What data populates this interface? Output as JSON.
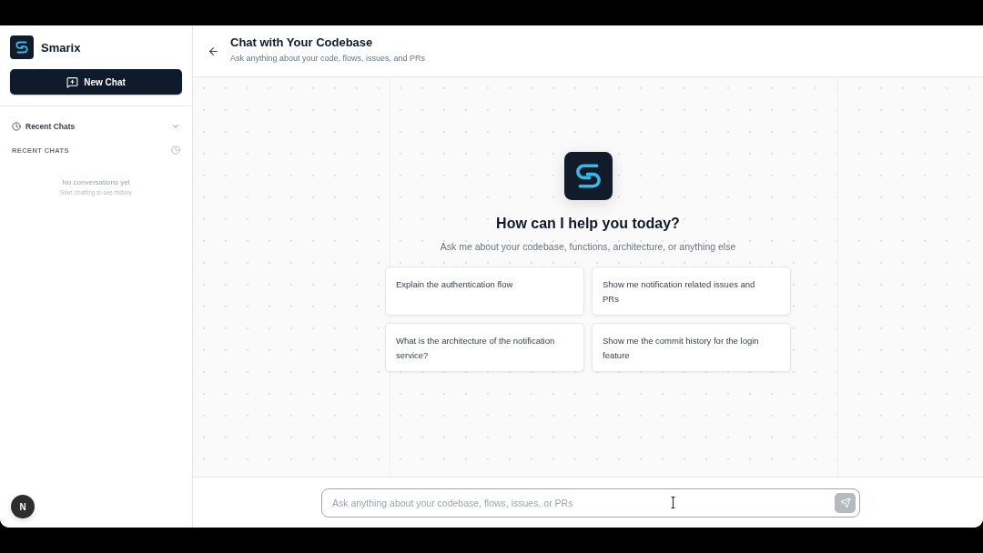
{
  "sidebar": {
    "brand": "Smarix",
    "new_chat_button": "New Chat",
    "recent_toggle": "Recent Chats",
    "history_heading": "RECENT CHATS",
    "empty_state": {
      "title": "No conversations yet",
      "subtitle": "Start chatting to see history"
    },
    "dev_badge": "N"
  },
  "header": {
    "title": "Chat with Your Codebase",
    "subtitle": "Ask anything about your code, flows, issues, and PRs"
  },
  "welcome": {
    "title": "How can I help you today?",
    "subtitle": "Ask me about your codebase, functions, architecture, or anything else"
  },
  "suggestions": [
    "Explain the authentication flow",
    "Show me notification related issues and PRs",
    "What is the architecture of the notification service?",
    "Show me the commit history for the login feature"
  ],
  "composer": {
    "placeholder": "Ask anything about your codebase, flows, issues, or PRs",
    "send_disabled": true
  }
}
